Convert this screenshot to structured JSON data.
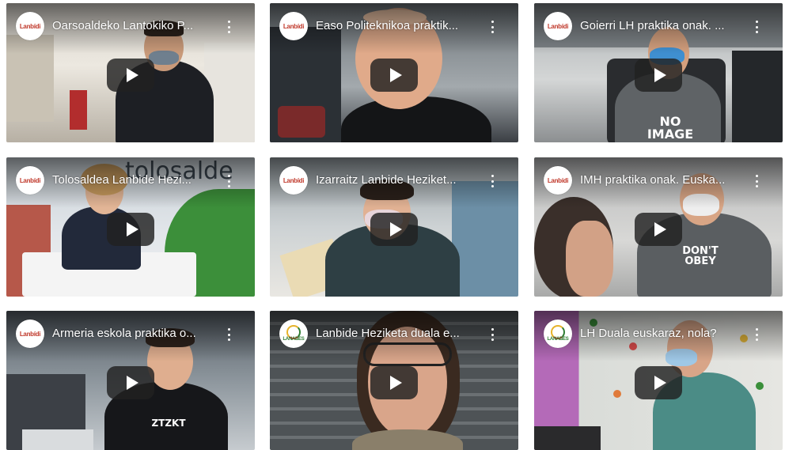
{
  "videos": [
    {
      "title": "Oarsoaldeko Lantokiko P...",
      "channel_logo_text": "Lanbídi",
      "logo": "red-logo"
    },
    {
      "title": "Easo Politeknikoa praktik...",
      "channel_logo_text": "Lanbídi",
      "logo": "red-logo"
    },
    {
      "title": "Goierri LH praktika onak. ...",
      "channel_logo_text": "Lanbídi",
      "logo": "red-logo",
      "shirt_text": "NO IMAGE"
    },
    {
      "title": "Tolosaldea Lanbide Hezi...",
      "channel_logo_text": "Lanbídi",
      "logo": "red-logo",
      "background_text": "tolosalde"
    },
    {
      "title": "Izarraitz Lanbide Heziket...",
      "channel_logo_text": "Lanbídi",
      "logo": "red-logo"
    },
    {
      "title": "IMH praktika onak. Euska...",
      "channel_logo_text": "Lanbídi",
      "logo": "red-logo",
      "shirt_text": "DON'T OBEY"
    },
    {
      "title": "Armeria eskola praktika o...",
      "channel_logo_text": "Lanbídi",
      "logo": "red-logo",
      "shirt_text": "ZTZKT"
    },
    {
      "title": "Lanbide Heziketa duala e...",
      "channel_logo_text": "LANABES",
      "logo": "lanabes-logo"
    },
    {
      "title": "LH Duala euskaraz, nola?",
      "channel_logo_text": "LANABES",
      "logo": "lanabes-logo"
    }
  ],
  "colors": {
    "play_button": "#212121",
    "title_text": "#ffffff",
    "logo_red": "#c0392b",
    "logo_green": "#2e7d32"
  },
  "icons": {
    "play": "play-icon",
    "menu": "more-vert-icon"
  }
}
